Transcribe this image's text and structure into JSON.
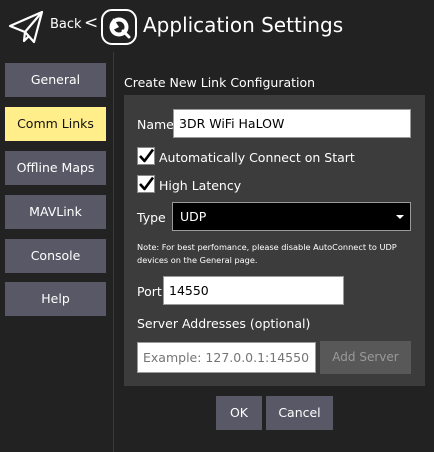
{
  "header": {
    "back_label": "Back",
    "separator": "<",
    "title": "Application Settings"
  },
  "sidebar": {
    "items": [
      {
        "label": "General",
        "active": false
      },
      {
        "label": "Comm Links",
        "active": true
      },
      {
        "label": "Offline Maps",
        "active": false
      },
      {
        "label": "MAVLink",
        "active": false
      },
      {
        "label": "Console",
        "active": false
      },
      {
        "label": "Help",
        "active": false
      }
    ]
  },
  "form": {
    "section_title": "Create New Link Configuration",
    "name_label": "Name",
    "name_value": "3DR WiFi HaLOW",
    "auto_connect_label": "Automatically Connect on Start",
    "auto_connect_checked": true,
    "high_latency_label": "High Latency",
    "high_latency_checked": true,
    "type_label": "Type",
    "type_value": "UDP",
    "note": "Note: For best perfomance, please disable AutoConnect to UDP devices on the General page.",
    "port_label": "Port",
    "port_value": "14550",
    "server_addresses_label": "Server Addresses (optional)",
    "server_placeholder": "Example: 127.0.0.1:14550",
    "add_server_label": "Add Server"
  },
  "dialog": {
    "ok_label": "OK",
    "cancel_label": "Cancel"
  },
  "colors": {
    "background": "#222222",
    "panel": "#3c3c3c",
    "button": "#585866",
    "active_button": "#ffee8a"
  }
}
